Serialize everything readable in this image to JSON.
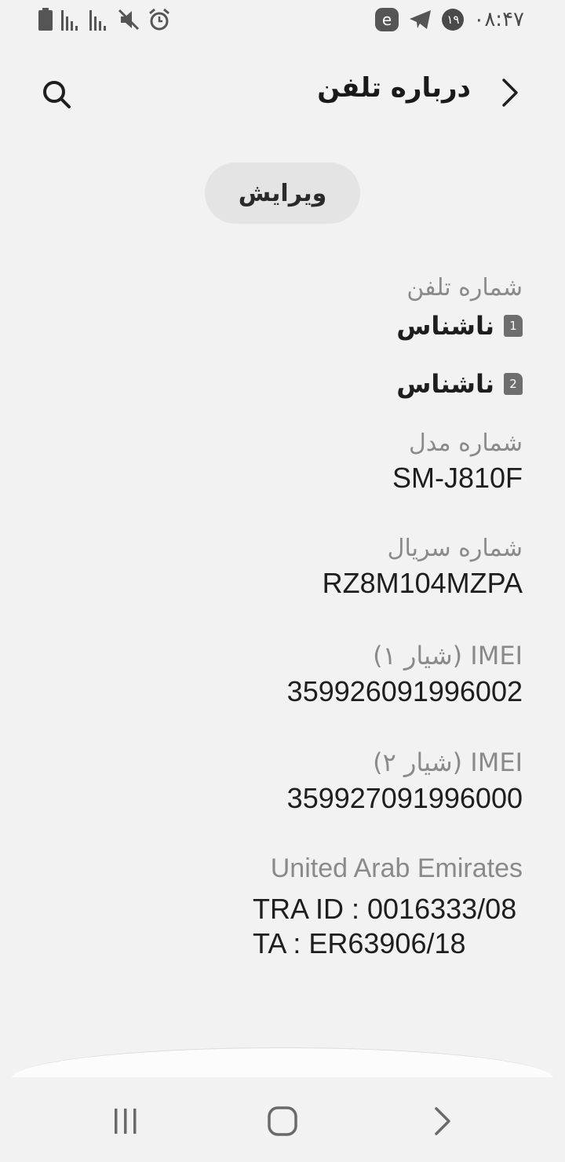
{
  "status_bar": {
    "time": "۰۸:۴۷",
    "notification_count": "۱۹"
  },
  "header": {
    "title": "درباره تلفن"
  },
  "edit_button": {
    "label": "ویرایش"
  },
  "phone_number": {
    "label": "شماره تلفن",
    "sims": [
      {
        "slot": "1",
        "value": "ناشناس"
      },
      {
        "slot": "2",
        "value": "ناشناس"
      }
    ]
  },
  "model_number": {
    "label": "شماره مدل",
    "value": "SM-J810F"
  },
  "serial_number": {
    "label": "شماره سریال",
    "value": "RZ8M104MZPA"
  },
  "imei1": {
    "label": "IMEI (شیار ۱)",
    "value": "359926091996002"
  },
  "imei2": {
    "label": "IMEI (شیار ۲)",
    "value": "359927091996000"
  },
  "regulatory": {
    "label": "United Arab Emirates",
    "tra_id": "TRA ID : 0016333/08",
    "ta": "TA : ER63906/18"
  }
}
